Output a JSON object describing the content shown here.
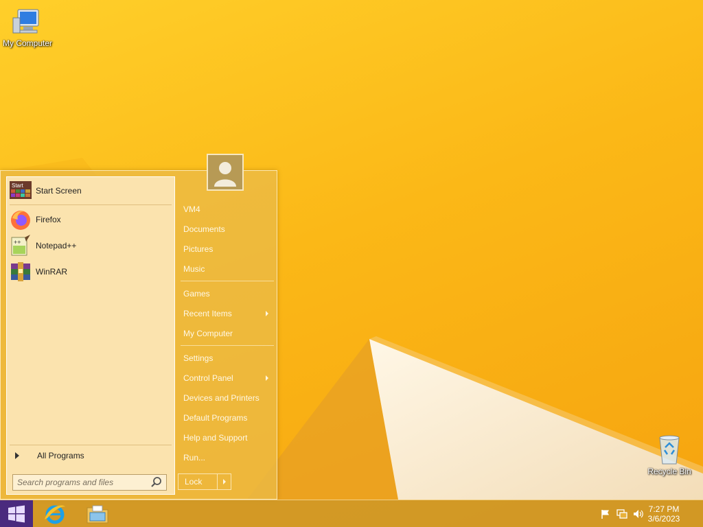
{
  "desktop": {
    "icons": [
      {
        "label": "My Computer",
        "icon": "computer-icon"
      },
      {
        "label": "Recycle Bin",
        "icon": "recycle-bin-icon"
      }
    ]
  },
  "start_menu": {
    "pinned": {
      "label": "Start Screen",
      "icon_text": "Start"
    },
    "programs": [
      {
        "label": "Firefox",
        "icon": "firefox-icon"
      },
      {
        "label": "Notepad++",
        "icon": "notepadpp-icon"
      },
      {
        "label": "WinRAR",
        "icon": "winrar-icon"
      }
    ],
    "all_programs_label": "All Programs",
    "search_placeholder": "Search programs and files",
    "right_items": [
      {
        "label": "VM4"
      },
      {
        "label": "Documents"
      },
      {
        "label": "Pictures"
      },
      {
        "label": "Music"
      },
      {
        "label": "Games"
      },
      {
        "label": "Recent Items",
        "submenu": true
      },
      {
        "label": "My Computer"
      },
      {
        "label": "Settings"
      },
      {
        "label": "Control Panel",
        "submenu": true
      },
      {
        "label": "Devices and Printers"
      },
      {
        "label": "Default Programs"
      },
      {
        "label": "Help and Support"
      },
      {
        "label": "Run..."
      }
    ],
    "lock_label": "Lock"
  },
  "taskbar": {
    "apps": [
      {
        "name": "internet-explorer",
        "icon": "internet-explorer-icon"
      },
      {
        "name": "file-explorer",
        "icon": "folder-icon"
      }
    ],
    "tray_icons": [
      "flag-icon",
      "network-icon",
      "volume-icon"
    ],
    "time": "7:27 PM",
    "date": "3/6/2023"
  },
  "colors": {
    "wallpaper": "#fbb817",
    "start_button": "#4a2a7e"
  }
}
